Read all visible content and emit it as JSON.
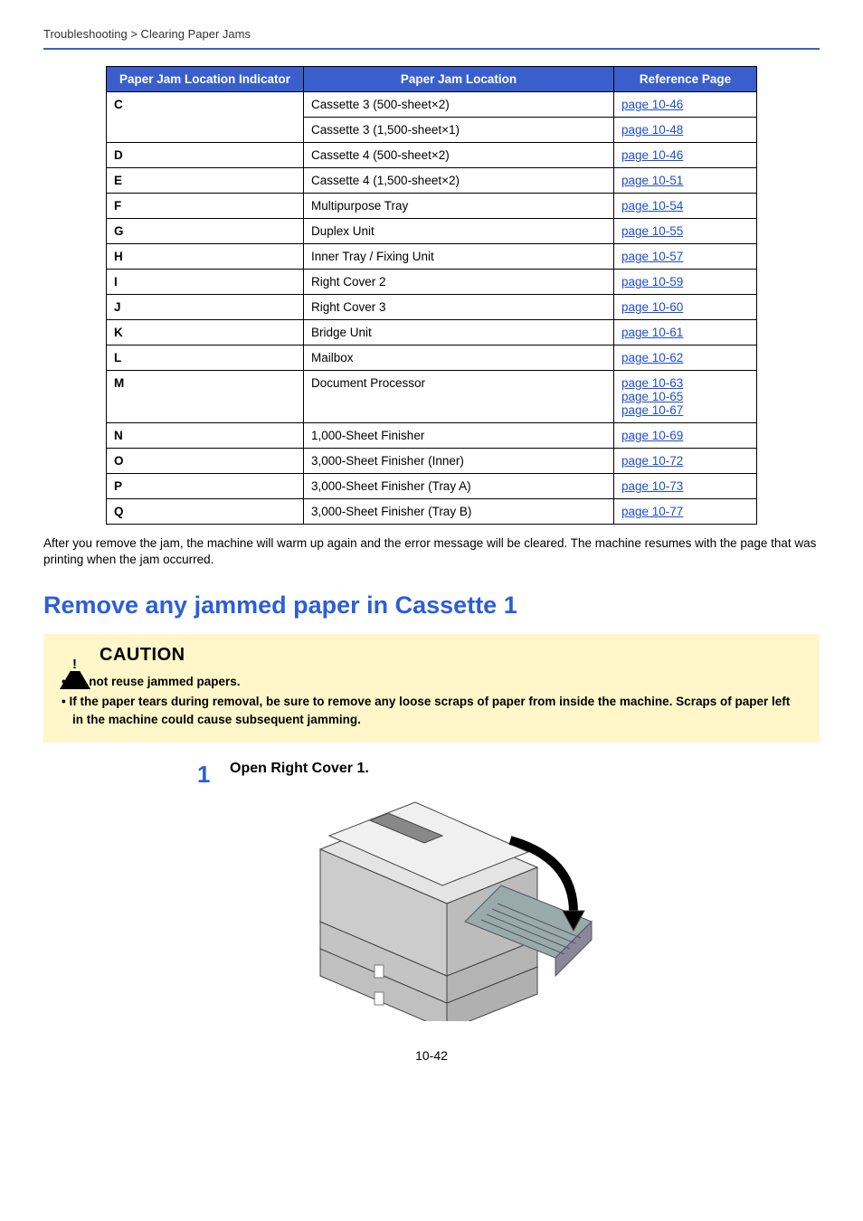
{
  "breadcrumb": "Troubleshooting > Clearing Paper Jams",
  "table": {
    "headers": {
      "indicator": "Paper Jam Location Indicator",
      "location": "Paper Jam Location",
      "reference": "Reference Page"
    },
    "rows": [
      {
        "ind": "C",
        "loc": "Cassette 3 (500-sheet×2)",
        "ref": "page 10-46"
      },
      {
        "ind": "",
        "loc": "Cassette 3 (1,500-sheet×1)",
        "ref": "page 10-48"
      },
      {
        "ind": "D",
        "loc": "Cassette 4 (500-sheet×2)",
        "ref": "page 10-46"
      },
      {
        "ind": "E",
        "loc": "Cassette 4 (1,500-sheet×2)",
        "ref": "page 10-51"
      },
      {
        "ind": "F",
        "loc": "Multipurpose Tray",
        "ref": "page 10-54"
      },
      {
        "ind": "G",
        "loc": "Duplex Unit",
        "ref": "page 10-55"
      },
      {
        "ind": "H",
        "loc": "Inner Tray / Fixing Unit",
        "ref": "page 10-57"
      },
      {
        "ind": "I",
        "loc": "Right Cover 2",
        "ref": "page 10-59"
      },
      {
        "ind": "J",
        "loc": "Right Cover 3",
        "ref": "page 10-60"
      },
      {
        "ind": "K",
        "loc": "Bridge Unit",
        "ref": "page 10-61"
      },
      {
        "ind": "L",
        "loc": "Mailbox",
        "ref": "page 10-62"
      },
      {
        "ind": "M",
        "loc": "Document Processor",
        "refs": [
          "page 10-63",
          "page 10-65",
          "page 10-67"
        ]
      },
      {
        "ind": "N",
        "loc": "1,000-Sheet Finisher",
        "ref": "page 10-69"
      },
      {
        "ind": "O",
        "loc": "3,000-Sheet Finisher (Inner)",
        "ref": "page 10-72"
      },
      {
        "ind": "P",
        "loc": "3,000-Sheet Finisher (Tray A)",
        "ref": "page 10-73"
      },
      {
        "ind": "Q",
        "loc": "3,000-Sheet Finisher (Tray B)",
        "ref": "page 10-77"
      }
    ]
  },
  "after_table": "After you remove the jam, the machine will warm up again and the error message will be cleared. The machine resumes with the page that was printing when the jam occurred.",
  "section_title": "Remove any jammed paper in Cassette 1",
  "caution": {
    "label": "CAUTION",
    "items": [
      "Do not reuse jammed papers.",
      "If the paper tears during removal, be sure to remove any loose scraps of paper from inside the machine. Scraps of paper left in the machine could cause subsequent jamming."
    ]
  },
  "step": {
    "number": "1",
    "title": "Open Right Cover 1."
  },
  "page_number": "10-42"
}
